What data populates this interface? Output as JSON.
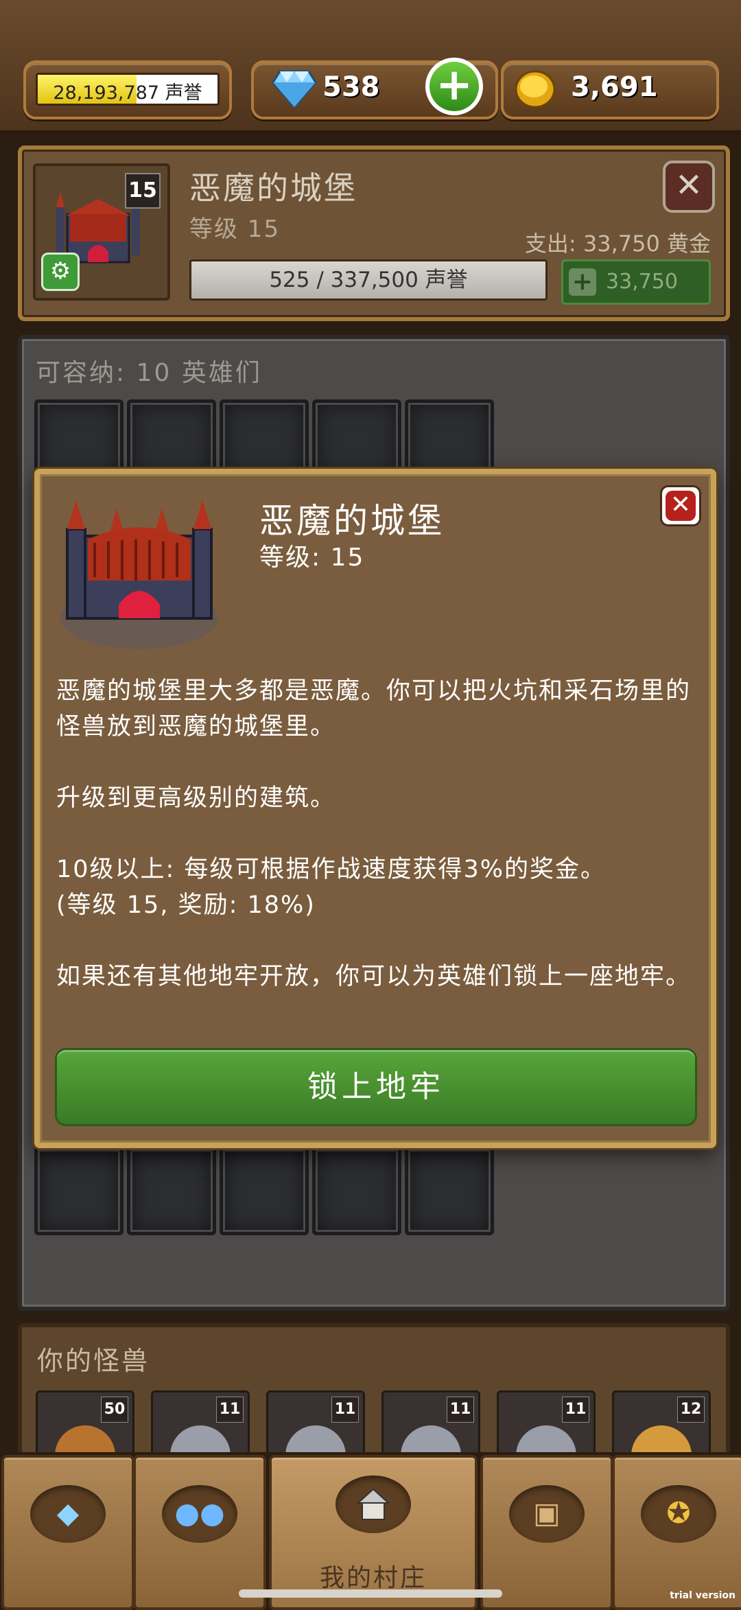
{
  "top_bar": {
    "reputation_value": "28,193,787",
    "reputation_unit": "声誉",
    "reputation_progress": 0.55,
    "gems": "538",
    "gold": "3,691"
  },
  "building_card": {
    "title": "恶魔的城堡",
    "level_label": "等级 15",
    "level_badge": "15",
    "cost_label": "支出: 33,750 黄金",
    "progress_text": "525 / 337,500 声誉",
    "buy_value": "33,750"
  },
  "dungeon": {
    "capacity_label": "可容纳: 10 英雄们"
  },
  "monsters": {
    "title": "你的怪兽",
    "items": [
      {
        "level": "50",
        "icon": "pharaoh-monster-icon"
      },
      {
        "level": "11",
        "icon": "gargoyle-monster-icon"
      },
      {
        "level": "11",
        "icon": "gargoyle-monster-icon"
      },
      {
        "level": "11",
        "icon": "gargoyle-monster-icon"
      },
      {
        "level": "11",
        "icon": "gargoyle-monster-icon"
      },
      {
        "level": "12",
        "icon": "ogre-monster-icon"
      }
    ]
  },
  "modal": {
    "title": "恶魔的城堡",
    "level": "等级: 15",
    "para1": "恶魔的城堡里大多都是恶魔。你可以把火坑和采石场里的怪兽放到恶魔的城堡里。",
    "para2": "升级到更高级别的建筑。",
    "para3a": "10级以上: 每级可根据作战速度获得3%的奖金。",
    "para3b": "(等级 15, 奖励: 18%)",
    "para4": "如果还有其他地牢开放，你可以为英雄们锁上一座地牢。",
    "button_label": "锁上地牢"
  },
  "bottom_nav": {
    "home_label": "我的村庄"
  },
  "watermark": "trial version"
}
